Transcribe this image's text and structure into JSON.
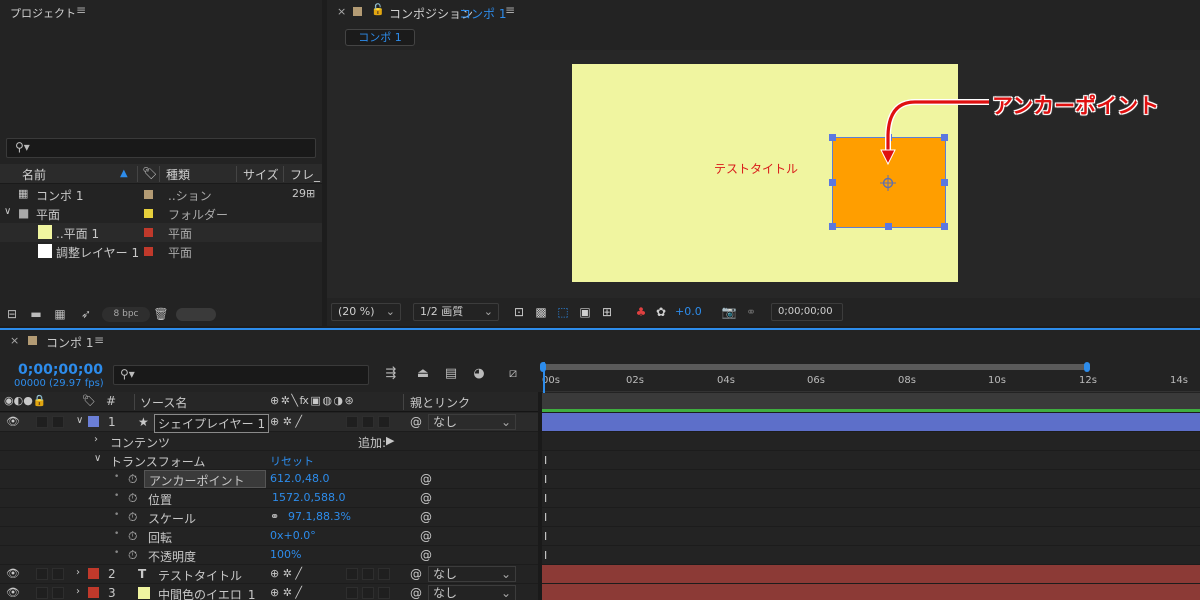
{
  "project": {
    "title": "プロジェクト",
    "menu": "≡",
    "search_icon": "⚲▾",
    "columns": {
      "name": "名前",
      "type": "種類",
      "size": "サイズ",
      "frame": "フレ_"
    },
    "items": [
      {
        "name": "コンポ 1",
        "type": "..ション",
        "size": "29",
        "color": "#b39b74"
      },
      {
        "name": "平面",
        "type": "フォルダー",
        "size": "",
        "color": "#e6d03c"
      },
      {
        "name": "..平面 1",
        "type": "平面",
        "size": "",
        "color": "#c0392b"
      },
      {
        "name": "調整レイヤー 1",
        "type": "平面",
        "size": "",
        "color": "#c0392b"
      }
    ],
    "footer": {
      "bpc": "8 bpc"
    }
  },
  "comp": {
    "close": "×",
    "label_prefix": "コンポジション",
    "name": "コンポ 1",
    "menu": "≡",
    "tab": "コンポ 1",
    "canvas": {
      "title_text": "テストタイトル",
      "annotation": "アンカーポイント",
      "canvas_color": "#f0f5a0",
      "shape_color": "#ff9e00"
    },
    "footer": {
      "zoom": "(20 %)",
      "resolution": "1/2 画質",
      "exposure": "+0.0",
      "timecode": "0;00;00;00"
    }
  },
  "timeline": {
    "close": "×",
    "name": "コンポ 1",
    "menu": "≡",
    "timecode": "0;00;00;00",
    "fps": "00000 (29.97 fps)",
    "search_icon": "⚲▾",
    "columns": {
      "hash": "#",
      "source": "ソース名",
      "switches": "⊕ ✲ ╲ fx ▣ ◍ ◑ ⊛",
      "parent": "親とリンク"
    },
    "layers": [
      {
        "num": "1",
        "name": "シェイプレイヤー 1",
        "parent": "なし",
        "color": "#6b7fd7"
      },
      {
        "num": "2",
        "name": "テストタイトル",
        "parent": "なし",
        "color": "#c0392b"
      },
      {
        "num": "3",
        "name": "中間色のイエロ_1",
        "parent": "なし",
        "color": "#c0392b"
      }
    ],
    "contents": {
      "label": "コンテンツ",
      "add": "追加:"
    },
    "transform": {
      "label": "トランスフォーム",
      "reset": "リセット",
      "props": [
        {
          "name": "アンカーポイント",
          "value": "612.0,48.0"
        },
        {
          "name": "位置",
          "value": "1572.0,588.0"
        },
        {
          "name": "スケール",
          "value": "97.1,88.3%"
        },
        {
          "name": "回転",
          "value": "0x+0.0°"
        },
        {
          "name": "不透明度",
          "value": "100%"
        }
      ]
    },
    "ruler": [
      "00s",
      "02s",
      "04s",
      "06s",
      "08s",
      "10s",
      "12s",
      "14s"
    ]
  }
}
